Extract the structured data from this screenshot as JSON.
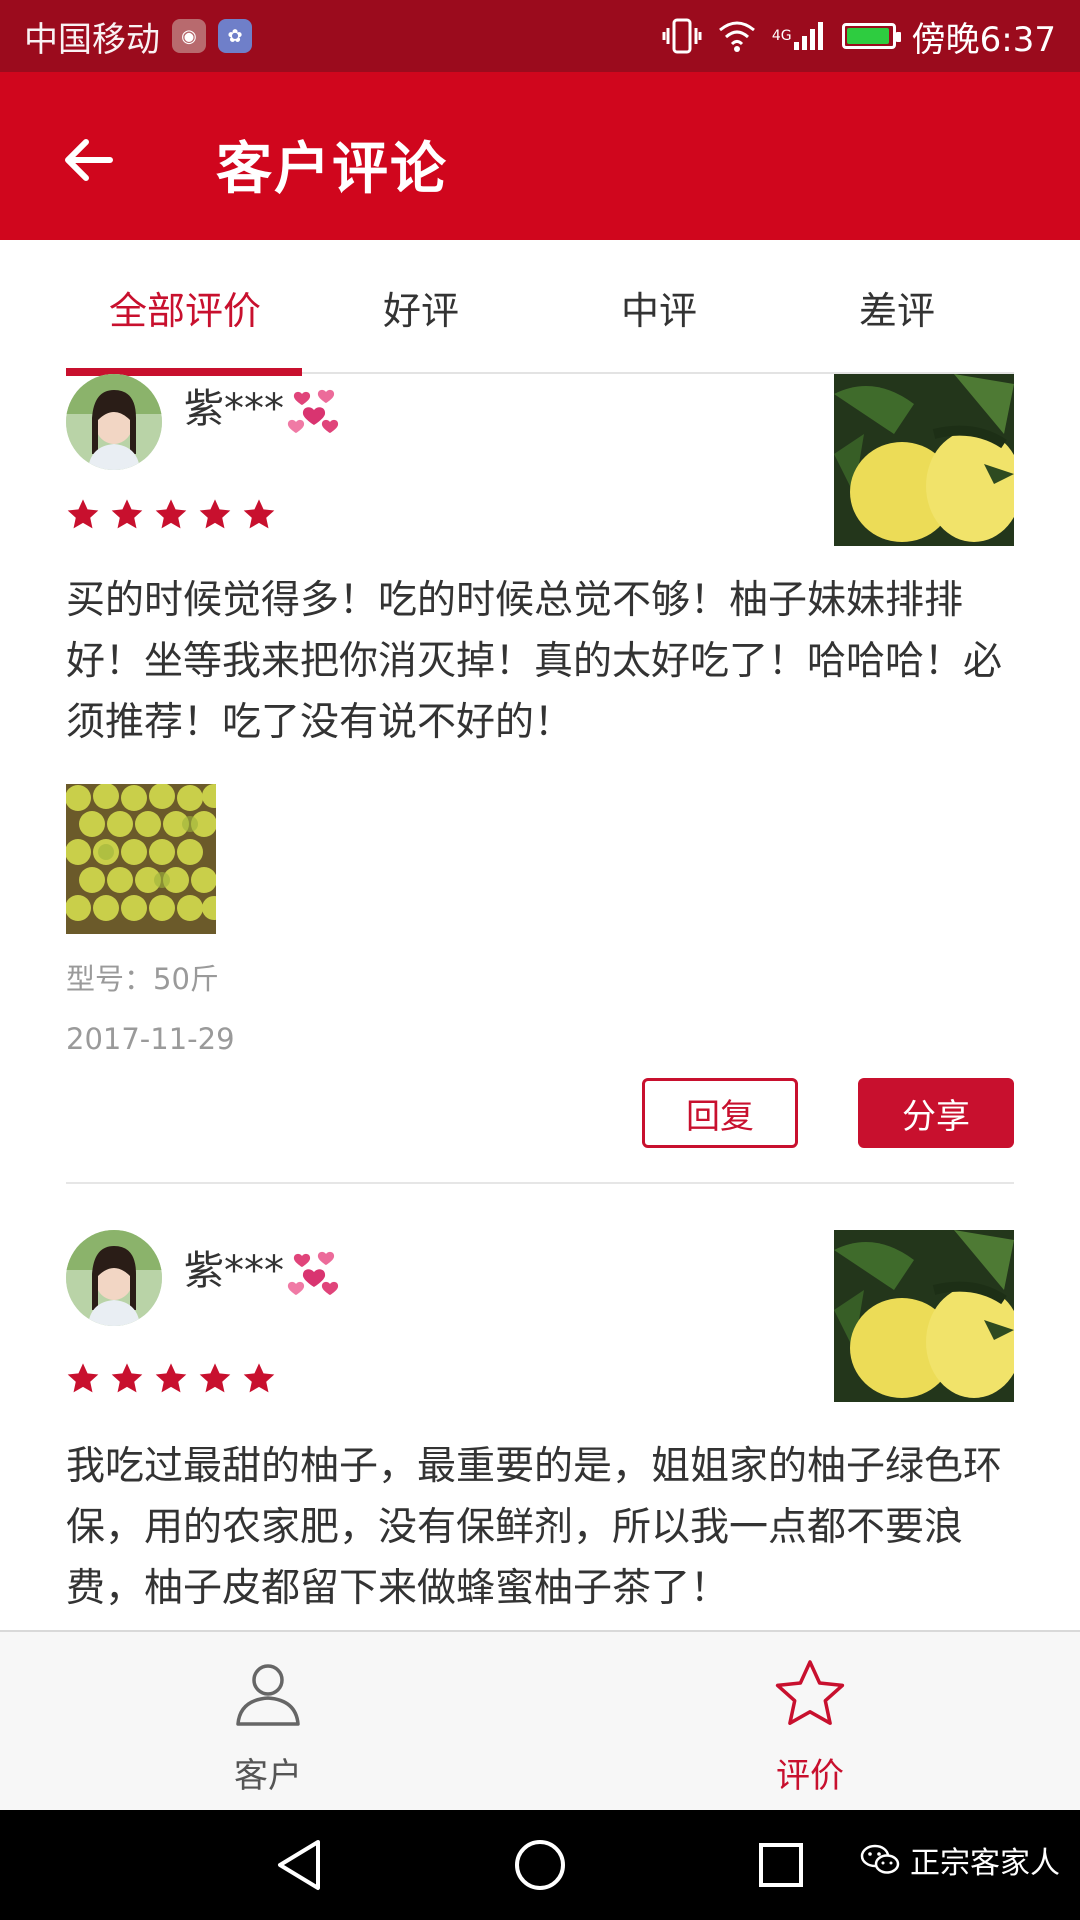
{
  "status_bar": {
    "carrier": "中国移动",
    "network": "4G",
    "time": "傍晚6:37"
  },
  "app_bar": {
    "title": "客户评论"
  },
  "tabs": [
    {
      "label": "全部评价",
      "active": true
    },
    {
      "label": "好评",
      "active": false
    },
    {
      "label": "中评",
      "active": false
    },
    {
      "label": "差评",
      "active": false
    }
  ],
  "reviews": [
    {
      "username": "紫***",
      "rating": 5,
      "text": "买的时候觉得多！吃的时候总觉不够！柚子妹妹排排好！坐等我来把你消灭掉！真的太好吃了！哈哈哈！必须推荐！吃了没有说不好的！",
      "model": "型号：50斤",
      "date": "2017-11-29",
      "reply_label": "回复",
      "share_label": "分享"
    },
    {
      "username": "紫***",
      "rating": 5,
      "text": "我吃过最甜的柚子，最重要的是，姐姐家的柚子绿色环保，用的农家肥，没有保鲜剂，所以我一点都不要浪费，柚子皮都留下来做蜂蜜柚子茶了！"
    }
  ],
  "bottom_nav": [
    {
      "label": "客户",
      "icon": "person-icon",
      "active": false
    },
    {
      "label": "评价",
      "icon": "star-outline-icon",
      "active": true
    }
  ],
  "watermark": "正宗客家人",
  "colors": {
    "primary": "#d0061d",
    "status_bar": "#9b0b1d",
    "accent": "#c8102e"
  }
}
